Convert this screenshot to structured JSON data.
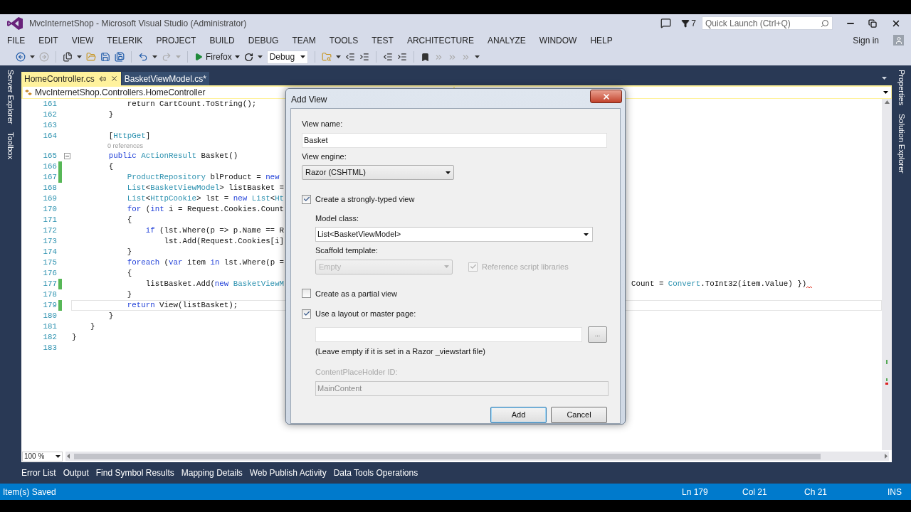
{
  "window": {
    "title": "MvcInternetShop - Microsoft Visual Studio (Administrator)",
    "notifications": "7",
    "quick_launch": {
      "placeholder": "Quick Launch (Ctrl+Q)"
    },
    "sign_in": "Sign in"
  },
  "menu": [
    "FILE",
    "EDIT",
    "VIEW",
    "TELERIK",
    "PROJECT",
    "BUILD",
    "DEBUG",
    "TEAM",
    "TOOLS",
    "TEST",
    "ARCHITECTURE",
    "ANALYZE",
    "WINDOW",
    "HELP"
  ],
  "toolbar": {
    "browser": "Firefox",
    "configuration": "Debug"
  },
  "left_strip": [
    "Server Explorer",
    "Toolbox"
  ],
  "right_strip": [
    "Properties",
    "Solution Explorer"
  ],
  "tabs": [
    {
      "label": "HomeController.cs",
      "selected": true
    },
    {
      "label": "BasketViewModel.cs*",
      "selected": false
    }
  ],
  "navigation_bar": {
    "class": "MvcInternetShop.Controllers.HomeController"
  },
  "editor": {
    "lines": [
      {
        "number": "161",
        "kind": "code",
        "changed": false,
        "current": false,
        "fold": false,
        "segments": [
          {
            "text": "            return CartCount.ToString();",
            "kind": "plain"
          }
        ]
      },
      {
        "number": "162",
        "kind": "code",
        "changed": false,
        "current": false,
        "fold": false,
        "segments": [
          {
            "text": "        }",
            "kind": "plain"
          }
        ]
      },
      {
        "number": "163",
        "kind": "code",
        "changed": false,
        "current": false,
        "fold": false
      },
      {
        "number": "164",
        "kind": "code",
        "changed": false,
        "current": false,
        "fold": false,
        "segments": [
          {
            "text": "        [",
            "kind": "plain"
          },
          {
            "text": "HttpGet",
            "kind": "type"
          },
          {
            "text": "]",
            "kind": "plain"
          }
        ]
      },
      {
        "kind": "codelens",
        "text": "0 references"
      },
      {
        "number": "165",
        "kind": "code",
        "changed": false,
        "current": false,
        "fold": true,
        "segments": [
          {
            "text": "        public ",
            "kind": "keyword"
          },
          {
            "text": "ActionResult",
            "kind": "type"
          },
          {
            "text": " Basket()",
            "kind": "plain"
          }
        ]
      },
      {
        "number": "166",
        "kind": "code",
        "changed": true,
        "current": false,
        "fold": false,
        "segments": [
          {
            "text": "        {",
            "kind": "plain"
          }
        ]
      },
      {
        "number": "167",
        "kind": "code",
        "changed": true,
        "current": false,
        "fold": false,
        "segments": [
          {
            "text": "            ProductRepository",
            "kind": "type"
          },
          {
            "text": " blProduct = ",
            "kind": "plain"
          },
          {
            "text": "new",
            "kind": "keyword"
          }
        ]
      },
      {
        "number": "168",
        "kind": "code",
        "changed": false,
        "current": false,
        "fold": false,
        "segments": [
          {
            "text": "            List",
            "kind": "type"
          },
          {
            "text": "<",
            "kind": "plain"
          },
          {
            "text": "BasketViewModel",
            "kind": "type"
          },
          {
            "text": "> listBasket =",
            "kind": "plain"
          }
        ]
      },
      {
        "number": "169",
        "kind": "code",
        "changed": false,
        "current": false,
        "fold": false,
        "segments": [
          {
            "text": "            List",
            "kind": "type"
          },
          {
            "text": "<",
            "kind": "plain"
          },
          {
            "text": "HttpCookie",
            "kind": "type"
          },
          {
            "text": "> lst = ",
            "kind": "plain"
          },
          {
            "text": "new ",
            "kind": "keyword"
          },
          {
            "text": "List",
            "kind": "type"
          },
          {
            "text": "<",
            "kind": "plain"
          },
          {
            "text": "Ht",
            "kind": "type"
          }
        ]
      },
      {
        "number": "170",
        "kind": "code",
        "changed": false,
        "current": false,
        "fold": false,
        "segments": [
          {
            "text": "            for",
            "kind": "keyword"
          },
          {
            "text": " (",
            "kind": "plain"
          },
          {
            "text": "int",
            "kind": "keyword"
          },
          {
            "text": " i = Request.Cookies.Count",
            "kind": "plain"
          }
        ]
      },
      {
        "number": "171",
        "kind": "code",
        "changed": false,
        "current": false,
        "fold": false,
        "segments": [
          {
            "text": "            {",
            "kind": "plain"
          }
        ]
      },
      {
        "number": "172",
        "kind": "code",
        "changed": false,
        "current": false,
        "fold": false,
        "segments": [
          {
            "text": "                if",
            "kind": "keyword"
          },
          {
            "text": " (lst.Where(p => p.Name == R",
            "kind": "plain"
          }
        ]
      },
      {
        "number": "173",
        "kind": "code",
        "changed": false,
        "current": false,
        "fold": false,
        "segments": [
          {
            "text": "                    lst.Add(Request.Cookies[i]",
            "kind": "plain"
          }
        ]
      },
      {
        "number": "174",
        "kind": "code",
        "changed": false,
        "current": false,
        "fold": false,
        "segments": [
          {
            "text": "            }",
            "kind": "plain"
          }
        ]
      },
      {
        "number": "175",
        "kind": "code",
        "changed": false,
        "current": false,
        "fold": false,
        "segments": [
          {
            "text": "            foreach",
            "kind": "keyword"
          },
          {
            "text": " (",
            "kind": "plain"
          },
          {
            "text": "var",
            "kind": "keyword"
          },
          {
            "text": " item ",
            "kind": "plain"
          },
          {
            "text": "in",
            "kind": "keyword"
          },
          {
            "text": " lst.Where(p =",
            "kind": "plain"
          }
        ]
      },
      {
        "number": "176",
        "kind": "code",
        "changed": false,
        "current": false,
        "fold": false,
        "segments": [
          {
            "text": "            {",
            "kind": "plain"
          }
        ]
      },
      {
        "number": "177",
        "kind": "code",
        "changed": true,
        "current": false,
        "fold": false,
        "segments": [
          {
            "text": "                listBasket.Add(",
            "kind": "plain"
          },
          {
            "text": "new ",
            "kind": "keyword"
          },
          {
            "text": "BasketViewM",
            "kind": "type"
          }
        ],
        "continuation": [
          {
            "text": "Count = ",
            "kind": "plain"
          },
          {
            "text": "Convert",
            "kind": "type"
          },
          {
            "text": ".ToInt32(item.Value) })",
            "kind": "plain"
          }
        ],
        "error": true
      },
      {
        "number": "178",
        "kind": "code",
        "changed": false,
        "current": false,
        "fold": false,
        "segments": [
          {
            "text": "            }",
            "kind": "plain"
          }
        ]
      },
      {
        "number": "179",
        "kind": "code",
        "changed": true,
        "current": true,
        "fold": false,
        "segments": [
          {
            "text": "            return",
            "kind": "keyword"
          },
          {
            "text": " View(listBasket);",
            "kind": "plain"
          }
        ]
      },
      {
        "number": "180",
        "kind": "code",
        "changed": false,
        "current": false,
        "fold": false,
        "segments": [
          {
            "text": "        }",
            "kind": "plain"
          }
        ]
      },
      {
        "number": "181",
        "kind": "code",
        "changed": false,
        "current": false,
        "fold": false,
        "segments": [
          {
            "text": "    }",
            "kind": "plain"
          }
        ]
      },
      {
        "number": "182",
        "kind": "code",
        "changed": false,
        "current": false,
        "fold": false,
        "segments": [
          {
            "text": "}",
            "kind": "plain"
          }
        ]
      },
      {
        "number": "183",
        "kind": "code",
        "changed": false,
        "current": false,
        "fold": false
      }
    ],
    "zoom": "100 %"
  },
  "dialog": {
    "title": "Add View",
    "view_name": {
      "label": "View name:",
      "value": "Basket"
    },
    "view_engine": {
      "label": "View engine:",
      "value": "Razor (CSHTML)"
    },
    "strongly_typed": {
      "label": "Create a strongly-typed view",
      "checked": true
    },
    "model_class": {
      "label": "Model class:",
      "value": "List<BasketViewModel>"
    },
    "scaffold_template": {
      "label": "Scaffold template:",
      "value": "Empty",
      "disabled": true
    },
    "reference_scripts": {
      "label": "Reference script libraries",
      "checked": true,
      "disabled": true
    },
    "partial_view": {
      "label": "Create as a partial view",
      "checked": false
    },
    "use_layout": {
      "label": "Use a layout or master page:",
      "checked": true
    },
    "browse_button": "...",
    "layout_note": "(Leave empty if it is set in a Razor _viewstart file)",
    "content_placeholder": {
      "label": "ContentPlaceHolder ID:",
      "value": "MainContent",
      "disabled": true
    },
    "buttons": [
      {
        "label": "Add",
        "default": true
      },
      {
        "label": "Cancel",
        "default": false
      }
    ]
  },
  "tool_tabs": [
    "Error List",
    "Output",
    "Find Symbol Results",
    "Mapping Details",
    "Web Publish Activity",
    "Data Tools Operations"
  ],
  "status_bar": {
    "message": "Item(s) Saved",
    "line": "Ln 179",
    "column": "Col 21",
    "char": "Ch 21",
    "mode": "INS"
  }
}
